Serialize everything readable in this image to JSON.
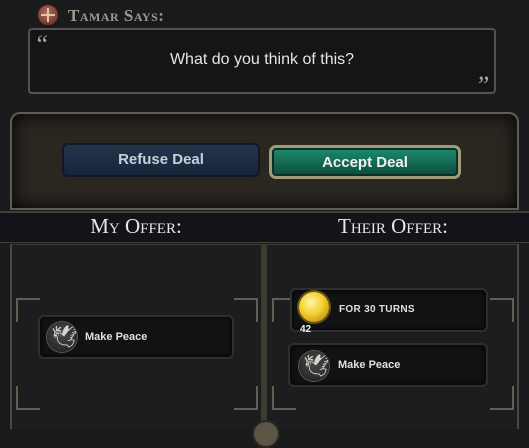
{
  "header": {
    "speaker": "Tamar Says:",
    "emblem_icon": "civ-emblem-icon"
  },
  "dialog": {
    "open_quote": "“",
    "close_quote": "”",
    "text": "What do you think of this?"
  },
  "actions": {
    "refuse_label": "Refuse Deal",
    "accept_label": "Accept Deal"
  },
  "offers": {
    "my_title": "My Offer:",
    "their_title": "Their Offer:",
    "my_items": [
      {
        "label": "Make Peace",
        "icon": "dove-icon"
      }
    ],
    "their_items": [
      {
        "label": "For 30 Turns",
        "icon": "gold-coin-icon",
        "amount": "42"
      },
      {
        "label": "Make Peace",
        "icon": "dove-icon"
      }
    ]
  },
  "colors": {
    "accept": "#147a5e",
    "refuse": "#1d2c40",
    "gold": "#f3cf2d"
  }
}
